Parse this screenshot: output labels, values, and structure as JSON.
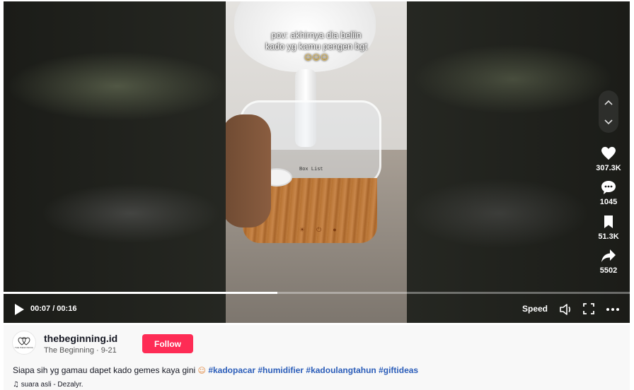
{
  "video": {
    "caption_line1": "pov: akhirnya dia beliin",
    "caption_line2": "kado yg kamu pengen bgt",
    "caption_emojis": "☺☺☺",
    "product_label": "Box List",
    "progress_fraction": 0.4375
  },
  "rail": {
    "nav_up_icon": "chevron-up-icon",
    "nav_down_icon": "chevron-down-icon",
    "likes": "307.3K",
    "comments": "1045",
    "bookmarks": "51.3K",
    "shares": "5502"
  },
  "controls": {
    "time": "00:07 / 00:16",
    "speed_label": "Speed"
  },
  "author": {
    "username": "thebeginning.id",
    "nickname": "The Beginning",
    "separator": " · ",
    "date": "9-21",
    "avatar_text": "THE BEGINNING",
    "follow_label": "Follow"
  },
  "description": {
    "text": "Siapa sih yg gamau dapet kado gemes kaya gini ",
    "emoji": "☺",
    "hashtags": [
      "#kadopacar",
      "#humidifier",
      "#kadoulangtahun",
      "#giftideas"
    ]
  },
  "music": {
    "label": "suara asli - Dezalyr."
  },
  "colors": {
    "follow": "#fe2c55",
    "hashtag": "#2b5db9"
  }
}
